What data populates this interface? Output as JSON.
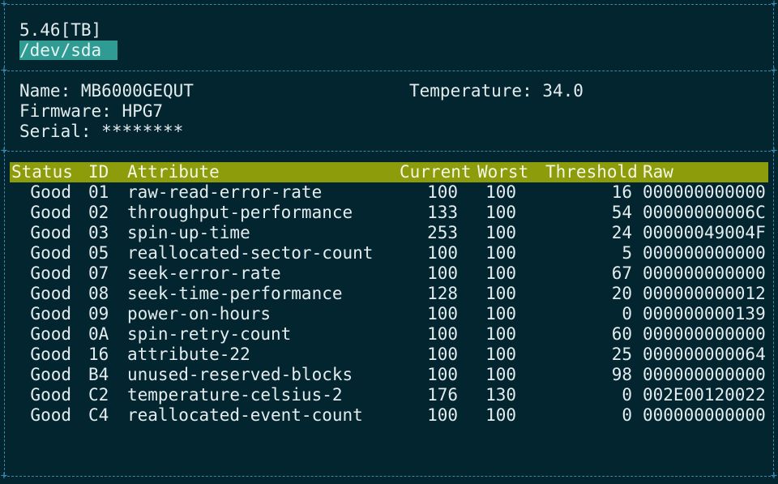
{
  "header": {
    "capacity": "5.46[TB]",
    "device": "/dev/sda"
  },
  "info": {
    "name_label": "Name:",
    "name_value": "MB6000GEQUT",
    "firmware_label": "Firmware:",
    "firmware_value": "HPG7",
    "serial_label": "Serial:",
    "serial_value": "********",
    "temperature_label": "Temperature:",
    "temperature_value": "34.0"
  },
  "table": {
    "headers": {
      "status": "Status",
      "id": "ID",
      "attribute": "Attribute",
      "current": "Current",
      "worst": "Worst",
      "threshold": "Threshold",
      "raw": "Raw"
    },
    "rows": [
      {
        "status": "Good",
        "id": "01",
        "attribute": "raw-read-error-rate",
        "current": "100",
        "worst": "100",
        "threshold": "16",
        "raw": "000000000000"
      },
      {
        "status": "Good",
        "id": "02",
        "attribute": "throughput-performance",
        "current": "133",
        "worst": "100",
        "threshold": "54",
        "raw": "00000000006C"
      },
      {
        "status": "Good",
        "id": "03",
        "attribute": "spin-up-time",
        "current": "253",
        "worst": "100",
        "threshold": "24",
        "raw": "00000049004F"
      },
      {
        "status": "Good",
        "id": "05",
        "attribute": "reallocated-sector-count",
        "current": "100",
        "worst": "100",
        "threshold": "5",
        "raw": "000000000000"
      },
      {
        "status": "Good",
        "id": "07",
        "attribute": "seek-error-rate",
        "current": "100",
        "worst": "100",
        "threshold": "67",
        "raw": "000000000000"
      },
      {
        "status": "Good",
        "id": "08",
        "attribute": "seek-time-performance",
        "current": "128",
        "worst": "100",
        "threshold": "20",
        "raw": "000000000012"
      },
      {
        "status": "Good",
        "id": "09",
        "attribute": "power-on-hours",
        "current": "100",
        "worst": "100",
        "threshold": "0",
        "raw": "000000000139"
      },
      {
        "status": "Good",
        "id": "0A",
        "attribute": "spin-retry-count",
        "current": "100",
        "worst": "100",
        "threshold": "60",
        "raw": "000000000000"
      },
      {
        "status": "Good",
        "id": "16",
        "attribute": "attribute-22",
        "current": "100",
        "worst": "100",
        "threshold": "25",
        "raw": "000000000064"
      },
      {
        "status": "Good",
        "id": "B4",
        "attribute": "unused-reserved-blocks",
        "current": "100",
        "worst": "100",
        "threshold": "98",
        "raw": "000000000000"
      },
      {
        "status": "Good",
        "id": "C2",
        "attribute": "temperature-celsius-2",
        "current": "176",
        "worst": "130",
        "threshold": "0",
        "raw": "002E00120022"
      },
      {
        "status": "Good",
        "id": "C4",
        "attribute": "reallocated-event-count",
        "current": "100",
        "worst": "100",
        "threshold": "0",
        "raw": "000000000000"
      }
    ]
  },
  "colors": {
    "background": "#022530",
    "border": "#3b87a8",
    "header_bar": "#8c9c0a",
    "device_highlight": "#2f9b93",
    "text": "#e4ecee"
  }
}
